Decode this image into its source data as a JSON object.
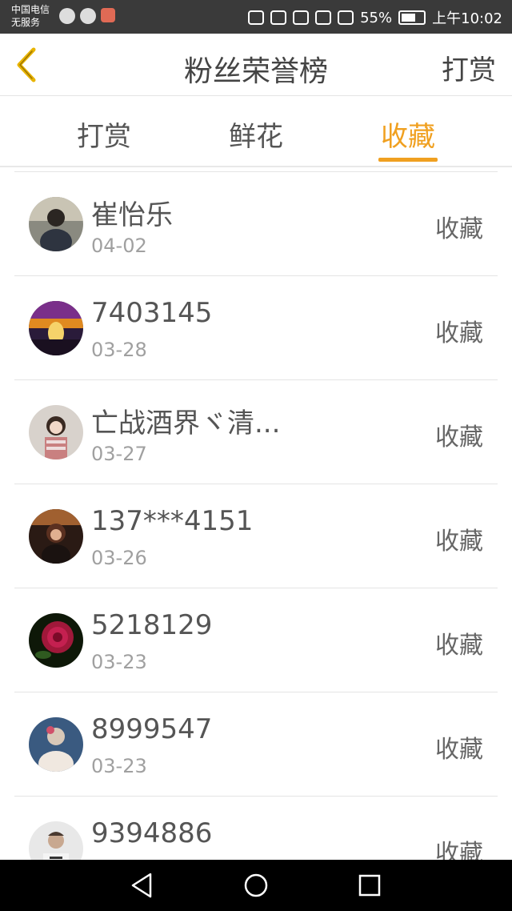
{
  "status_bar": {
    "carrier_line1": "中国电信",
    "carrier_line2": "无服务",
    "battery_percent": "55%",
    "time": "上午10:02"
  },
  "header": {
    "title": "粉丝荣誉榜",
    "right_button": "打赏"
  },
  "tabs": [
    {
      "label": "打赏",
      "active": false
    },
    {
      "label": "鲜花",
      "active": false
    },
    {
      "label": "收藏",
      "active": true
    }
  ],
  "colors": {
    "accent": "#f0a020",
    "text": "#555555",
    "muted": "#a0a0a0"
  },
  "list": [
    {
      "name": "崔怡乐",
      "date": "04-02",
      "action": "收藏",
      "avatar": "photo-avatar"
    },
    {
      "name": "7403145",
      "date": "03-28",
      "action": "收藏",
      "avatar": "sunset-avatar"
    },
    {
      "name": "亡战酒界ヾ清...",
      "date": "03-27",
      "action": "收藏",
      "avatar": "photo-avatar"
    },
    {
      "name": "137***4151",
      "date": "03-26",
      "action": "收藏",
      "avatar": "photo-avatar"
    },
    {
      "name": "5218129",
      "date": "03-23",
      "action": "收藏",
      "avatar": "rose-avatar"
    },
    {
      "name": "8999547",
      "date": "03-23",
      "action": "收藏",
      "avatar": "photo-avatar"
    },
    {
      "name": "9394886",
      "date": "",
      "action": "收藏",
      "avatar": "photo-avatar"
    }
  ]
}
